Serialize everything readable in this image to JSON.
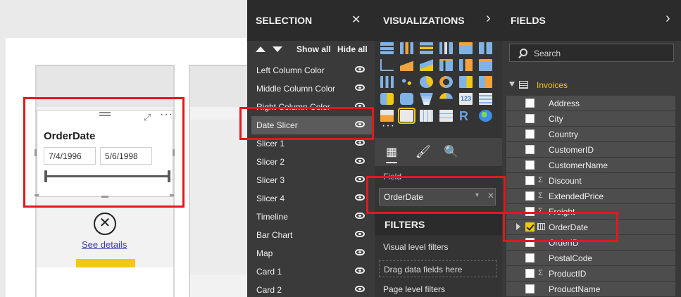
{
  "canvas": {
    "slicer": {
      "title": "OrderDate",
      "from": "7/4/1996",
      "to": "5/6/1998"
    },
    "see_details": "See details",
    "close_glyph": "✕",
    "focus_glyph": "⤢",
    "more_glyph": "···"
  },
  "selection": {
    "title": "SELECTION",
    "close_glyph": "✕",
    "show_all": "Show all",
    "hide_all": "Hide all",
    "items": [
      {
        "label": "Left Column Color"
      },
      {
        "label": "Middle Column Color"
      },
      {
        "label": "Right Column Color"
      },
      {
        "label": "Date Slicer"
      },
      {
        "label": "Slicer 1"
      },
      {
        "label": "Slicer 2"
      },
      {
        "label": "Slicer 3"
      },
      {
        "label": "Slicer 4"
      },
      {
        "label": "Timeline"
      },
      {
        "label": "Bar Chart"
      },
      {
        "label": "Map"
      },
      {
        "label": "Card 1"
      },
      {
        "label": "Card 2"
      }
    ]
  },
  "visualizations": {
    "title": "VISUALIZATIONS",
    "chevron": "›",
    "more": "···",
    "tabs": {
      "fields": "▦",
      "format": "🖌",
      "analytics": "🔍"
    },
    "field_label": "Field",
    "field_value": "OrderDate",
    "field_caret": "▾",
    "field_remove": "✕",
    "filters_title": "FILTERS",
    "visual_level": "Visual level filters",
    "drag_here": "Drag data fields here",
    "page_level": "Page level filters"
  },
  "fields": {
    "title": "FIELDS",
    "chevron": "›",
    "search_placeholder": "Search",
    "table_name": "Invoices",
    "sigma": "Σ",
    "items": [
      {
        "label": "Address"
      },
      {
        "label": "City"
      },
      {
        "label": "Country"
      },
      {
        "label": "CustomerID"
      },
      {
        "label": "CustomerName"
      },
      {
        "label": "Discount"
      },
      {
        "label": "ExtendedPrice"
      },
      {
        "label": "Freight"
      },
      {
        "label": "OrderDate"
      },
      {
        "label": "OrderID"
      },
      {
        "label": "PostalCode"
      },
      {
        "label": "ProductID"
      },
      {
        "label": "ProductName"
      }
    ]
  },
  "colors": {
    "accent": "#f2c811",
    "highlight": "#e0191f",
    "pane": "#3a3a3a"
  }
}
